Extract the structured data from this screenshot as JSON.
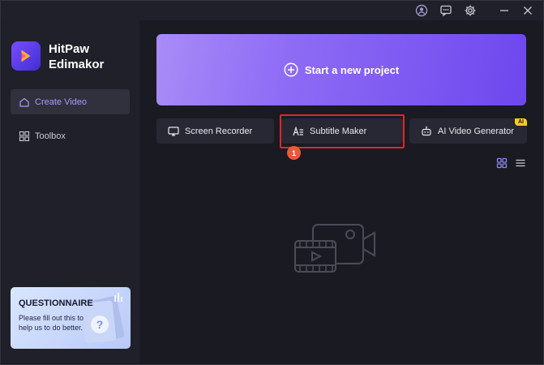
{
  "app": {
    "name_line1": "HitPaw",
    "name_line2": "Edimakor"
  },
  "titlebar": {
    "icons": [
      "account-icon",
      "feedback-icon",
      "settings-icon",
      "minimize-icon",
      "close-icon"
    ]
  },
  "sidebar": {
    "items": [
      {
        "label": "Create Video",
        "icon": "home-icon",
        "active": true
      },
      {
        "label": "Toolbox",
        "icon": "grid-icon",
        "active": false
      }
    ],
    "promo": {
      "title": "QUESTIONNAIRE",
      "text": "Please fill out this to help us to do better."
    }
  },
  "main": {
    "new_project_label": "Start a new project",
    "tools": [
      {
        "label": "Screen Recorder",
        "icon": "screen-recorder-icon"
      },
      {
        "label": "Subtitle Maker",
        "icon": "subtitle-icon"
      },
      {
        "label": "AI Video Generator",
        "icon": "robot-icon",
        "badge": "AI"
      }
    ],
    "step_badge": "1",
    "view_modes": [
      "grid-view-icon",
      "list-view-icon"
    ],
    "empty_state_icon": "video-camera-icon"
  },
  "colors": {
    "accent": "#a79bff",
    "highlight": "#e0262b",
    "banner_start": "#a98cf7",
    "banner_end": "#6e47ee",
    "ai_badge": "#ffc928"
  }
}
